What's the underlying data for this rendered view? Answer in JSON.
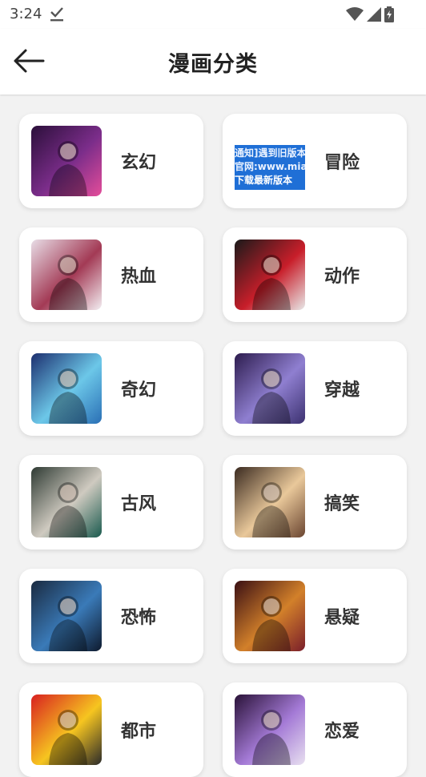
{
  "status": {
    "time": "3:24"
  },
  "header": {
    "title": "漫画分类"
  },
  "categories": [
    {
      "label": "玄幻",
      "colors": [
        "#2b0f3a",
        "#7b2d8a",
        "#e44d9a"
      ]
    },
    {
      "label": "冒险",
      "colors": [
        "#1f6fd6",
        "#ffffff",
        "#0a3fa0"
      ],
      "banner": [
        "通知]遇到旧版本",
        "官网:www.miao",
        "下载最新版本"
      ]
    },
    {
      "label": "热血",
      "colors": [
        "#e8dde6",
        "#a33a55",
        "#f3eef2"
      ]
    },
    {
      "label": "动作",
      "colors": [
        "#1a1a1a",
        "#c81e2a",
        "#e8e8e8"
      ]
    },
    {
      "label": "奇幻",
      "colors": [
        "#1c2e6e",
        "#6cc7e8",
        "#2a6fb5"
      ]
    },
    {
      "label": "穿越",
      "colors": [
        "#2d1c4e",
        "#8f7fd0",
        "#3c3170"
      ]
    },
    {
      "label": "古风",
      "colors": [
        "#2e3a33",
        "#cfcac0",
        "#1a5a4e"
      ]
    },
    {
      "label": "搞笑",
      "colors": [
        "#3a2a20",
        "#e9c89a",
        "#6a4530"
      ]
    },
    {
      "label": "恐怖",
      "colors": [
        "#1a2a40",
        "#3a7ab8",
        "#0e1a2e"
      ]
    },
    {
      "label": "悬疑",
      "colors": [
        "#3a0f14",
        "#d2802a",
        "#7a1e2a"
      ]
    },
    {
      "label": "都市",
      "colors": [
        "#d82020",
        "#f6c520",
        "#2a2a2a"
      ]
    },
    {
      "label": "恋爱",
      "colors": [
        "#2a1238",
        "#a47ad6",
        "#e8e0f0"
      ]
    }
  ]
}
